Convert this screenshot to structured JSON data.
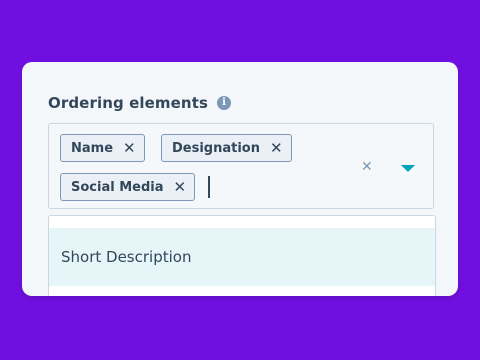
{
  "field": {
    "label": "Ordering elements",
    "info_icon": "info-icon"
  },
  "tags": [
    {
      "label": "Name",
      "remove_icon": "close-icon"
    },
    {
      "label": "Designation",
      "remove_icon": "close-icon"
    },
    {
      "label": "Social Media",
      "remove_icon": "close-icon"
    }
  ],
  "controls": {
    "clear_icon": "close-icon",
    "toggle_icon": "caret-down-icon",
    "accent_color": "#00a4bd"
  },
  "menu": {
    "items": [
      {
        "label": "Short Description",
        "highlighted": true
      }
    ]
  }
}
